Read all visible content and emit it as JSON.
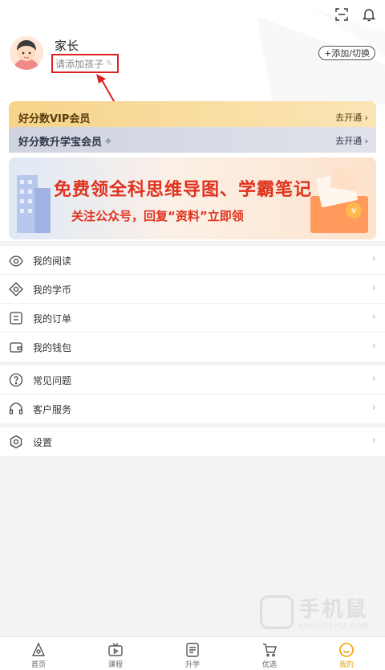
{
  "profile": {
    "name": "家长",
    "add_child_label": "请添加孩子",
    "add_switch_label": "+添加/切换"
  },
  "vip": {
    "title": "好分数VIP会员",
    "open_label": "去开通"
  },
  "sxb": {
    "title": "好分数升学宝会员",
    "open_label": "去开通"
  },
  "banner": {
    "line1": "免费领全科思维导图、学霸笔记",
    "line2": "关注公众号，回复“资料”立即领"
  },
  "menu1": [
    {
      "label": "我的阅读",
      "icon": "eye-icon"
    },
    {
      "label": "我的学币",
      "icon": "coin-icon"
    },
    {
      "label": "我的订单",
      "icon": "order-icon"
    },
    {
      "label": "我的钱包",
      "icon": "wallet-icon"
    }
  ],
  "menu2": [
    {
      "label": "常见问题",
      "icon": "question-icon"
    },
    {
      "label": "客户服务",
      "icon": "headset-icon"
    }
  ],
  "menu3": [
    {
      "label": "设置",
      "icon": "settings-icon"
    }
  ],
  "tabs": [
    {
      "label": "首页",
      "icon": "home-icon"
    },
    {
      "label": "课程",
      "icon": "tv-icon"
    },
    {
      "label": "升学",
      "icon": "doc-icon"
    },
    {
      "label": "优选",
      "icon": "cart-icon"
    },
    {
      "label": "我的",
      "icon": "user-icon",
      "active": true
    }
  ],
  "watermark": {
    "big": "手机鼠",
    "small": "SHOUJISHU.COM"
  },
  "colors": {
    "accent": "#f0a000",
    "annotation": "#e02020",
    "vip_gold": "#f7d48a"
  }
}
